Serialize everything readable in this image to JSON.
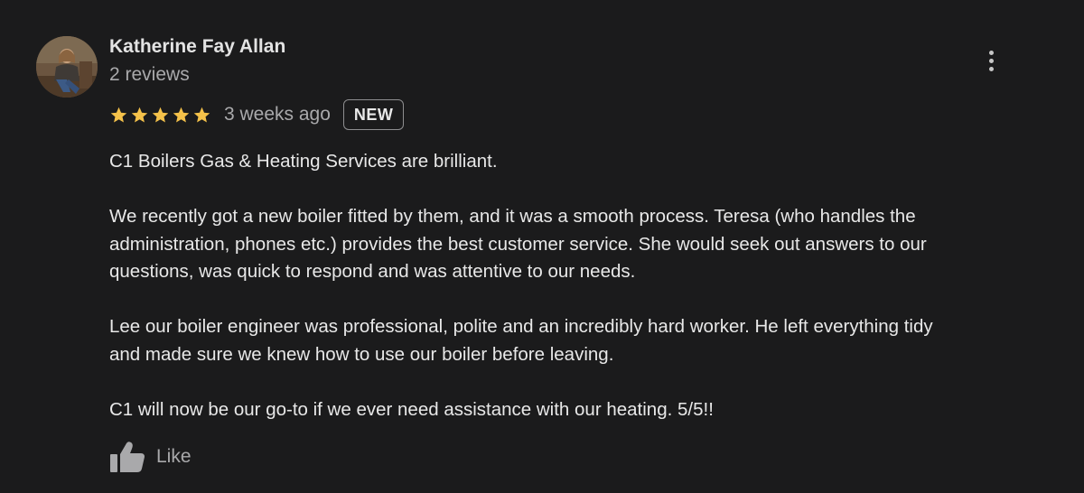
{
  "author": {
    "name": "Katherine Fay Allan",
    "reviews": "2 reviews"
  },
  "rating": {
    "stars": 5,
    "max": 5,
    "star_color": "#f5c24a"
  },
  "date": "3 weeks ago",
  "badge": "NEW",
  "body": {
    "line1": "C1 Boilers Gas & Heating Services are brilliant.",
    "line2": "We recently got a new boiler fitted by them, and it was a smooth process. Teresa (who handles the",
    "line3": "administration, phones etc.) provides the best customer service. She would seek out answers to our",
    "line4": "questions, was quick to respond and was attentive to our needs.",
    "line5": "Lee our boiler engineer was professional, polite and an incredibly hard worker. He left everything tidy",
    "line6": "and made sure we knew how to use our boiler before leaving.",
    "line7": "C1 will now be our go-to if we ever need assistance with our heating. 5/5!!"
  },
  "actions": {
    "like_label": "Like",
    "like_icon": "thumbs-up-icon",
    "menu_icon": "more-vert-icon"
  }
}
